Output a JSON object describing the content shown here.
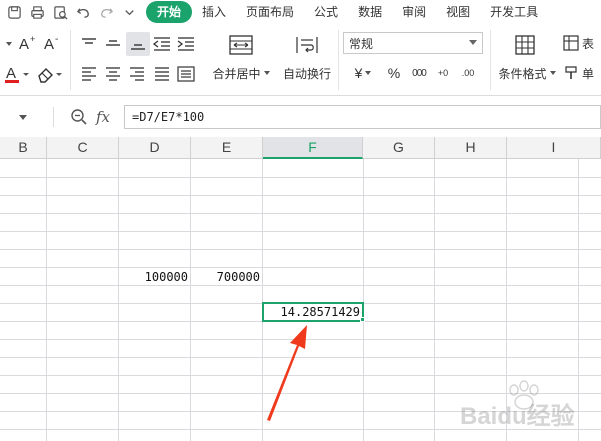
{
  "menu": {
    "quick_access": [
      "save-icon",
      "print-icon",
      "print-preview-icon",
      "undo-icon",
      "redo-icon",
      "more-icon"
    ],
    "tabs": [
      "开始",
      "插入",
      "页面布局",
      "公式",
      "数据",
      "审阅",
      "视图",
      "开发工具"
    ],
    "active_tab": "开始"
  },
  "ribbon": {
    "merge_center_label": "合并居中",
    "wrap_text_label": "自动换行",
    "number_format_value": "常规",
    "conditional_format_label": "条件格式",
    "table_style_label": "表",
    "cell_label": "单",
    "currency_symbol": "¥",
    "percent_symbol": "%",
    "thousands_label": "000",
    "increase_decimal_label": "+0",
    "decrease_decimal_label": ".00",
    "accent_color": "#1aa36b",
    "font_color": "#e02020"
  },
  "formula_bar": {
    "fx_label": "fx",
    "formula": "=D7/E7*100"
  },
  "grid": {
    "columns": [
      {
        "label": "B",
        "selected": false
      },
      {
        "label": "C",
        "selected": false
      },
      {
        "label": "D",
        "selected": false
      },
      {
        "label": "E",
        "selected": false
      },
      {
        "label": "F",
        "selected": true
      },
      {
        "label": "G",
        "selected": false
      },
      {
        "label": "H",
        "selected": false
      },
      {
        "label": "I",
        "selected": false
      }
    ],
    "cells": {
      "D7": "100000",
      "E7": "700000",
      "F8": "14.28571429"
    },
    "selected_cell": "F8",
    "annotation_color": "#f03a1e"
  },
  "watermark": {
    "text": "Baidu经验"
  }
}
